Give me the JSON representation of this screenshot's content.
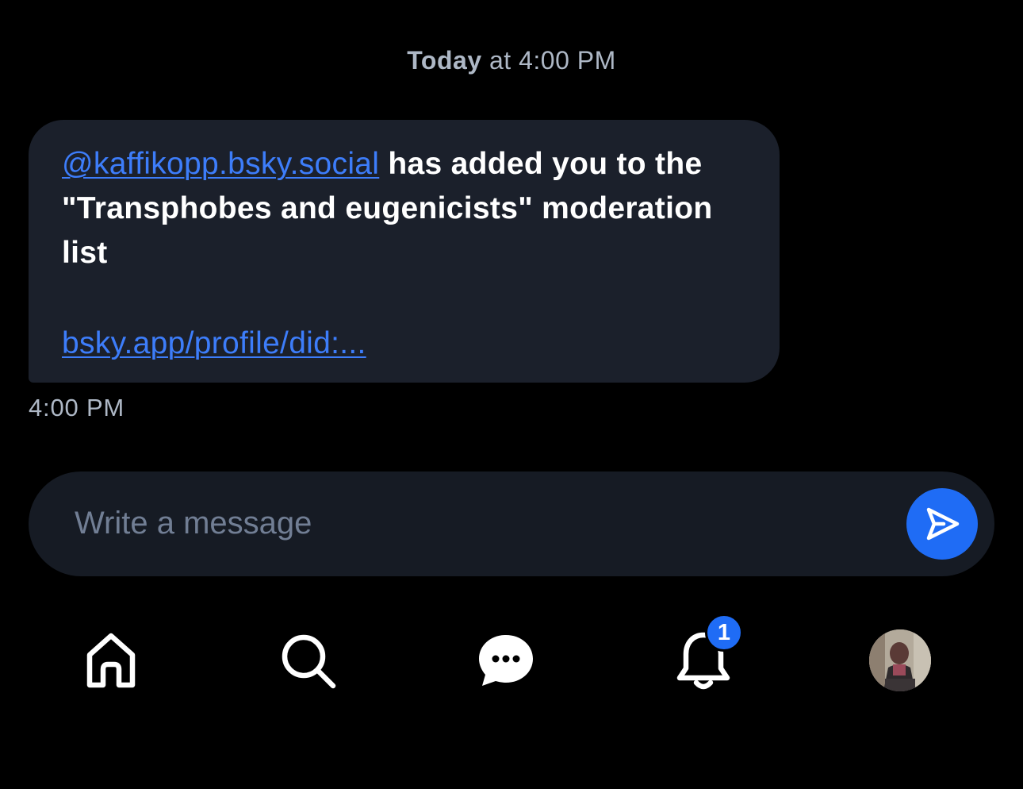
{
  "conversation": {
    "date_header": {
      "day": "Today",
      "rest": "at 4:00 PM"
    },
    "message": {
      "mention": "@kaffikopp.bsky.social",
      "body": "has added you to the \"Transphobes and eugenicists\" moderation list",
      "link": "bsky.app/profile/did:...",
      "time": "4:00 PM"
    }
  },
  "composer": {
    "placeholder": "Write a message",
    "send_icon": "send-icon"
  },
  "tabbar": {
    "items": [
      {
        "name": "home",
        "icon": "home-icon"
      },
      {
        "name": "search",
        "icon": "search-icon"
      },
      {
        "name": "chat",
        "icon": "chat-bubble-icon"
      },
      {
        "name": "notifications",
        "icon": "bell-icon",
        "badge": "1"
      },
      {
        "name": "profile",
        "icon": "avatar"
      }
    ]
  },
  "colors": {
    "accent": "#1f6cf5",
    "link": "#3d7dfa",
    "bubble": "#1b202b",
    "muted_text": "#aeb8c6"
  }
}
